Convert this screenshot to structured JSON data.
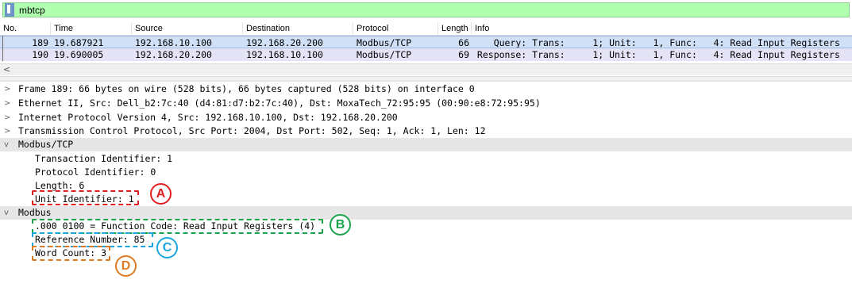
{
  "filter": {
    "value": "mbtcp"
  },
  "columns": [
    "No.",
    "Time",
    "Source",
    "Destination",
    "Protocol",
    "Length",
    "Info"
  ],
  "packets": [
    {
      "no": "189",
      "time": "19.687921",
      "src": "192.168.10.100",
      "dst": "192.168.20.200",
      "proto": "Modbus/TCP",
      "len": "66",
      "info": "    Query: Trans:     1; Unit:   1, Func:   4: Read Input Registers"
    },
    {
      "no": "190",
      "time": "19.690005",
      "src": "192.168.20.200",
      "dst": "192.168.10.100",
      "proto": "Modbus/TCP",
      "len": "69",
      "info": " Response: Trans:     1; Unit:   1, Func:   4: Read Input Registers"
    }
  ],
  "scroll": {
    "left_arrow": "<"
  },
  "tree": {
    "frame": "Frame 189: 66 bytes on wire (528 bits), 66 bytes captured (528 bits) on interface 0",
    "ethernet": "Ethernet II, Src: Dell_b2:7c:40 (d4:81:d7:b2:7c:40), Dst: MoxaTech_72:95:95 (00:90:e8:72:95:95)",
    "ip": "Internet Protocol Version 4, Src: 192.168.10.100, Dst: 192.168.20.200",
    "tcp": "Transmission Control Protocol, Src Port: 2004, Dst Port: 502, Seq: 1, Ack: 1, Len: 12",
    "mbtcp": "Modbus/TCP",
    "trans_id": "Transaction Identifier: 1",
    "proto_id": "Protocol Identifier: 0",
    "length": "Length: 6",
    "unit_id": "Unit Identifier: 1",
    "modbus": "Modbus",
    "func_code": ".000 0100 = Function Code: Read Input Registers (4)",
    "ref_num": "Reference Number: 85",
    "word_count": "Word Count: 3",
    "chev_collapsed": ">",
    "chev_expanded": "v"
  },
  "annotations": [
    {
      "letter": "A",
      "color": "#e02020"
    },
    {
      "letter": "B",
      "color": "#1aa34a"
    },
    {
      "letter": "C",
      "color": "#1ba6e0"
    },
    {
      "letter": "D",
      "color": "#e07a20"
    }
  ]
}
